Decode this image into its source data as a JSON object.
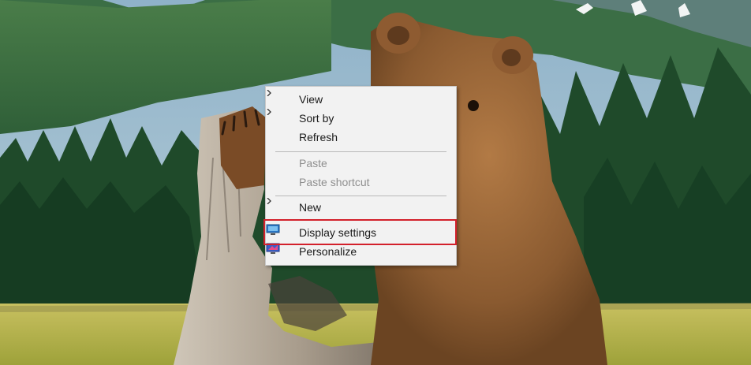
{
  "context_menu": {
    "items": [
      {
        "label": "View",
        "submenu": true,
        "enabled": true
      },
      {
        "label": "Sort by",
        "submenu": true,
        "enabled": true
      },
      {
        "label": "Refresh",
        "submenu": false,
        "enabled": true
      },
      {
        "label": "Paste",
        "submenu": false,
        "enabled": false
      },
      {
        "label": "Paste shortcut",
        "submenu": false,
        "enabled": false
      },
      {
        "label": "New",
        "submenu": true,
        "enabled": true
      },
      {
        "label": "Display settings",
        "submenu": false,
        "enabled": true,
        "icon": "display-icon",
        "highlighted": true
      },
      {
        "label": "Personalize",
        "submenu": false,
        "enabled": true,
        "icon": "personalize-icon"
      }
    ]
  },
  "colors": {
    "highlight_border": "#d3202b",
    "menu_background": "#f2f2f2",
    "disabled_text": "#8f8f8f"
  }
}
